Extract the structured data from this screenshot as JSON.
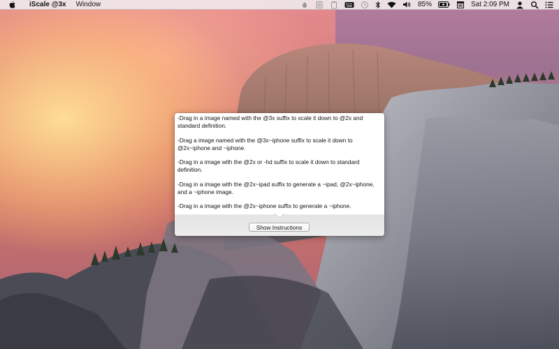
{
  "menubar": {
    "apple_icon": "apple-logo-icon",
    "app_name": "iScale @3x",
    "menus": [
      "Window"
    ],
    "battery_percent": "85%",
    "clock": "Sat 2:09 PM"
  },
  "popover": {
    "instructions": [
      "-Drag in a image named with the @3x suffix to scale it down to @2x and standard definition.",
      "-Drag a image named with the @3x~iphone suffix to scale it down to @2x~iphone and ~iphone.",
      "-Drag in a image with the @2x or -hd suffix to scale it down to standard definition.",
      "-Drag in a image with the @2x~ipad suffix to generate a ~ipad, @2x~iphone, and a ~iphone image.",
      "-Drag in a image with the @2x~iphone suffix to generate a ~iphone."
    ],
    "show_button_label": "Show Instructions"
  },
  "colors": {
    "menubar_bg": "#f0e8ea",
    "popover_bg": "#ededed",
    "instructions_bg": "#ffffff"
  }
}
